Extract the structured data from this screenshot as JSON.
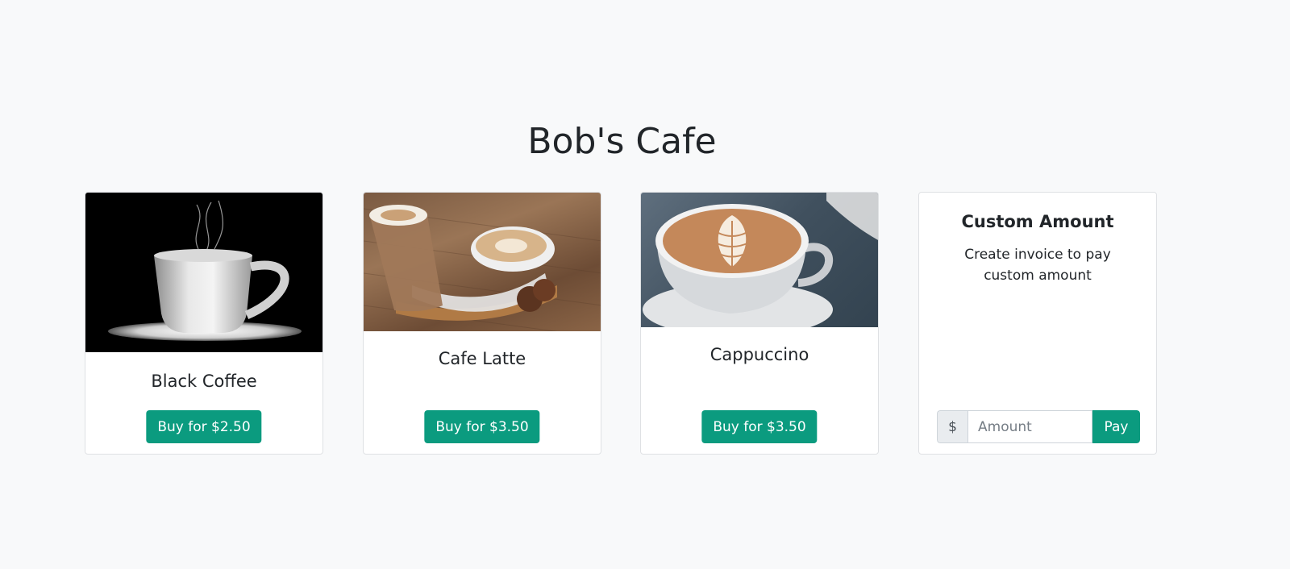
{
  "page": {
    "title": "Bob's Cafe"
  },
  "accent_color": "#0b9b7f",
  "products": [
    {
      "name": "Black Coffee",
      "button_label": "Buy for $2.50",
      "image": "black-coffee-cup-image"
    },
    {
      "name": "Cafe Latte",
      "button_label": "Buy for $3.50",
      "image": "cafe-latte-image"
    },
    {
      "name": "Cappuccino",
      "button_label": "Buy for $3.50",
      "image": "cappuccino-image"
    }
  ],
  "custom": {
    "title": "Custom Amount",
    "description": "Create invoice to pay custom amount",
    "currency_symbol": "$",
    "amount_placeholder": "Amount",
    "pay_label": "Pay"
  }
}
